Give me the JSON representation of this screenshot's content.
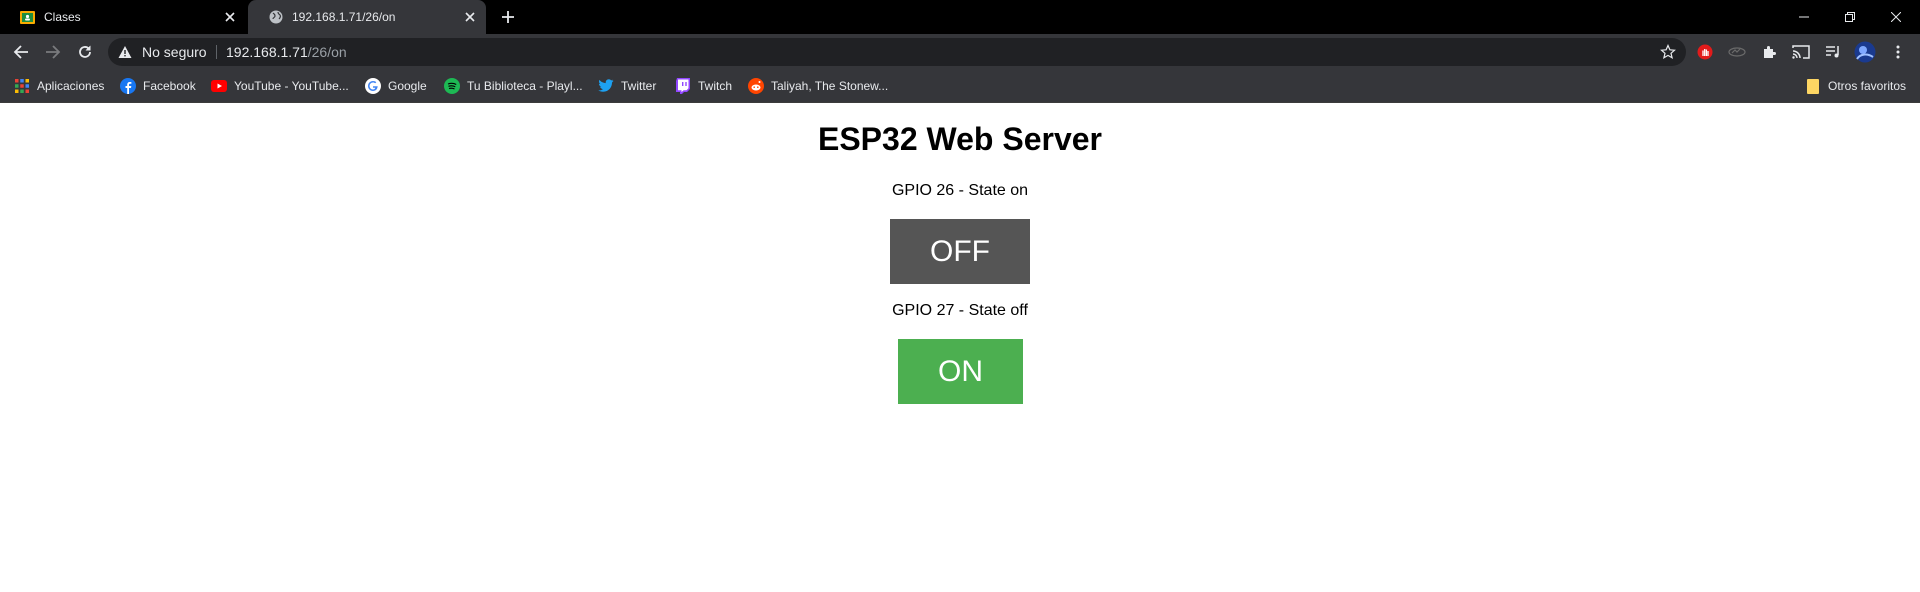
{
  "browser": {
    "tabs": [
      {
        "title": "Clases",
        "favicon": "classroom-icon",
        "active": false
      },
      {
        "title": "192.168.1.71/26/on",
        "favicon": "globe-icon",
        "active": true
      }
    ],
    "address": {
      "security_label": "No seguro",
      "host": "192.168.1.71",
      "path": "/26/on"
    },
    "bookmarks": [
      {
        "label": "Aplicaciones",
        "icon": "apps-grid-icon"
      },
      {
        "label": "Facebook",
        "icon": "facebook-icon"
      },
      {
        "label": "YouTube - YouTube...",
        "icon": "youtube-icon"
      },
      {
        "label": "Google",
        "icon": "google-icon"
      },
      {
        "label": "Tu Biblioteca - Playl...",
        "icon": "spotify-icon"
      },
      {
        "label": "Twitter",
        "icon": "twitter-icon"
      },
      {
        "label": "Twitch",
        "icon": "twitch-icon"
      },
      {
        "label": "Taliyah, The Stonew...",
        "icon": "reddit-icon"
      }
    ],
    "other_bookmarks": "Otros favoritos"
  },
  "page": {
    "heading": "ESP32 Web Server",
    "gpio": [
      {
        "status": "GPIO 26 - State on",
        "button_label": "OFF",
        "button_color": "#555555"
      },
      {
        "status": "GPIO 27 - State off",
        "button_label": "ON",
        "button_color": "#4caf50"
      }
    ]
  }
}
